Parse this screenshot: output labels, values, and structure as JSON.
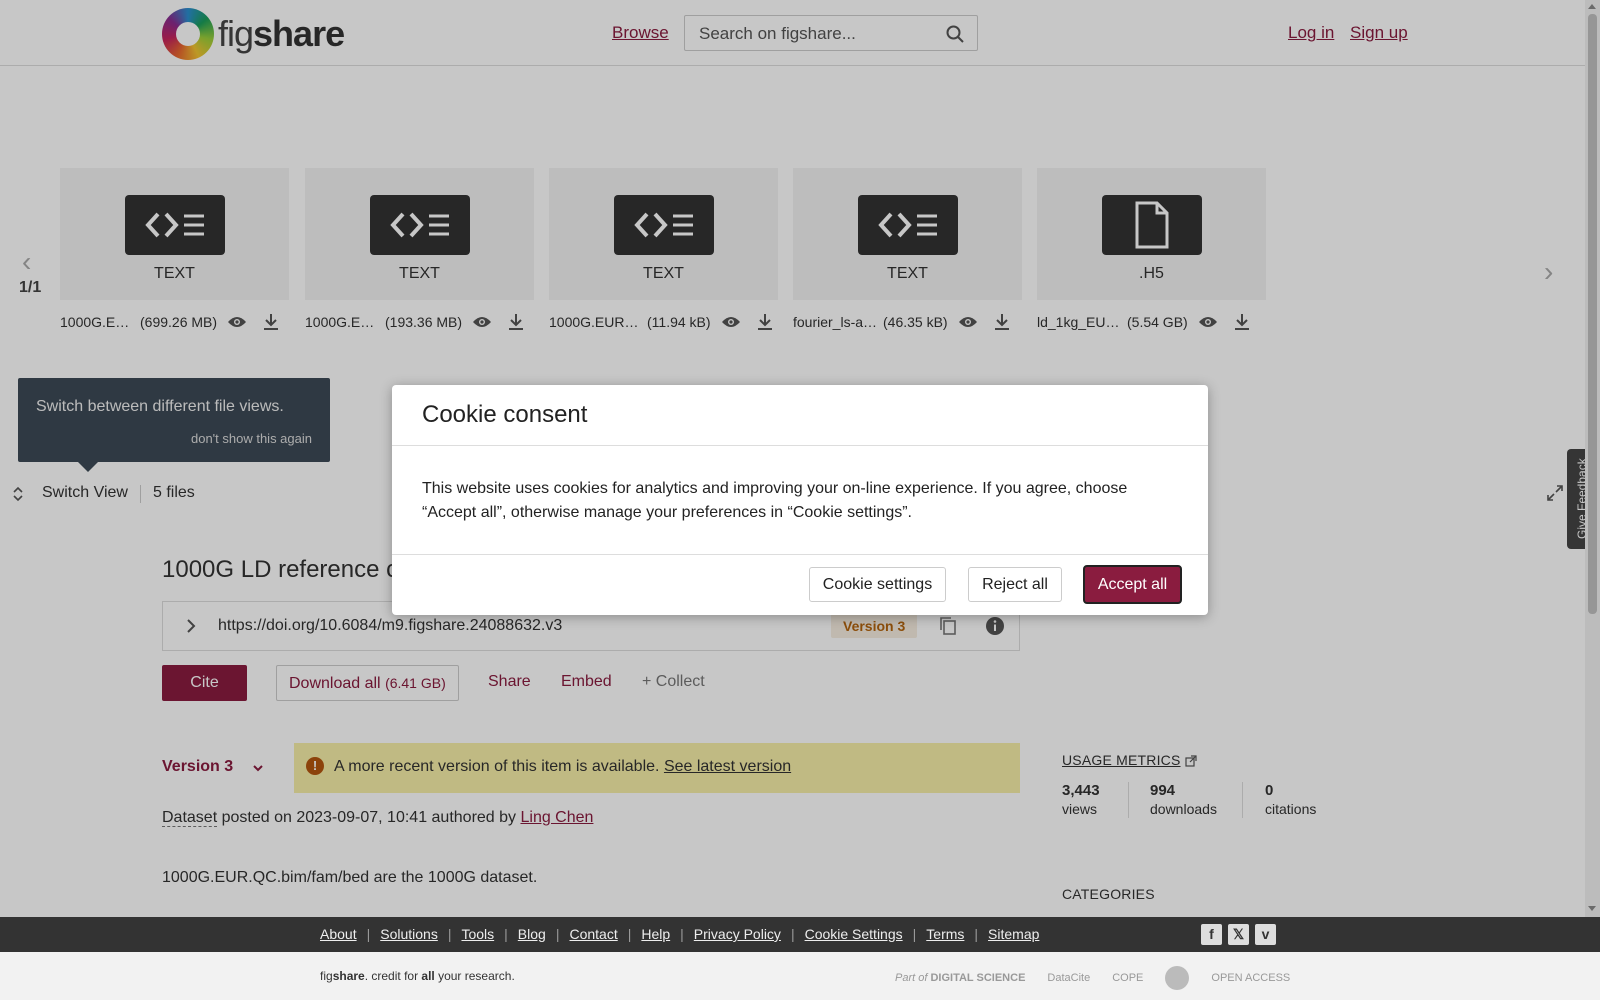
{
  "header": {
    "logo_light": "fig",
    "logo_bold": "share",
    "browse": "Browse",
    "search_placeholder": "Search on figshare...",
    "login": "Log in",
    "signup": "Sign up"
  },
  "carousel": {
    "counter": "1/1",
    "files": [
      {
        "type": "TEXT",
        "name": "1000G.E…",
        "size": "(699.26 MB)",
        "icon": "code-file-icon"
      },
      {
        "type": "TEXT",
        "name": "1000G.E…",
        "size": "(193.36 MB)",
        "icon": "code-file-icon"
      },
      {
        "type": "TEXT",
        "name": "1000G.EUR…",
        "size": "(11.94 kB)",
        "icon": "code-file-icon"
      },
      {
        "type": "TEXT",
        "name": "fourier_ls-al…",
        "size": "(46.35 kB)",
        "icon": "code-file-icon"
      },
      {
        "type": ".H5",
        "name": "ld_1kg_EU…",
        "size": "(5.54 GB)",
        "icon": "document-file-icon"
      }
    ]
  },
  "tooltip": {
    "text": "Switch between different file views.",
    "dismiss": "don't show this again"
  },
  "switch_bar": {
    "label": "Switch View",
    "files_count": "5 files"
  },
  "item": {
    "title": "1000G LD reference c",
    "doi": "https://doi.org/10.6084/m9.figshare.24088632.v3",
    "version_badge": "Version 3",
    "cite": "Cite",
    "download_all": "Download all",
    "download_size": "(6.41 GB)",
    "share": "Share",
    "embed": "Embed",
    "collect": "+ Collect",
    "version_select": "Version 3",
    "notice_text": "A more recent version of this item is available.",
    "notice_link": "See latest version",
    "dataset_label": "Dataset",
    "posted_text": " posted on 2023-09-07, 10:41 authored by ",
    "author": "Ling Chen",
    "description": "1000G.EUR.QC.bim/fam/bed are the 1000G dataset."
  },
  "metrics": {
    "heading": "USAGE METRICS",
    "views_value": "3,443",
    "views_label": "views",
    "downloads_value": "994",
    "downloads_label": "downloads",
    "citations_value": "0",
    "citations_label": "citations",
    "categories": "CATEGORIES"
  },
  "feedback": "Give Feedback",
  "cookie_modal": {
    "title": "Cookie consent",
    "body": "This website uses cookies for analytics and improving your on-line experience. If you agree, choose “Accept all”, otherwise manage your preferences in “Cookie settings”.",
    "settings": "Cookie settings",
    "reject": "Reject all",
    "accept": "Accept all"
  },
  "footer": {
    "links": [
      "About",
      "Solutions",
      "Tools",
      "Blog",
      "Contact",
      "Help",
      "Privacy Policy",
      "Cookie Settings",
      "Terms",
      "Sitemap"
    ],
    "social": [
      "facebook-icon",
      "x-twitter-icon",
      "vimeo-icon"
    ],
    "tagline_light": "fig",
    "tagline_bold": "share",
    "tagline_rest1": ". credit for ",
    "tagline_bold2": "all",
    "tagline_rest2": " your research.",
    "partner_digital_prefix": "Part of",
    "partner_digital": "DIGITAL SCIENCE",
    "partner_datacite": "DataCite",
    "partner_cope": "COPE",
    "partner_openaccess": "OPEN ACCESS"
  },
  "colors": {
    "brand": "#8a1c3f",
    "notice_bg": "#f7efa8",
    "footer_bg": "#333333"
  }
}
